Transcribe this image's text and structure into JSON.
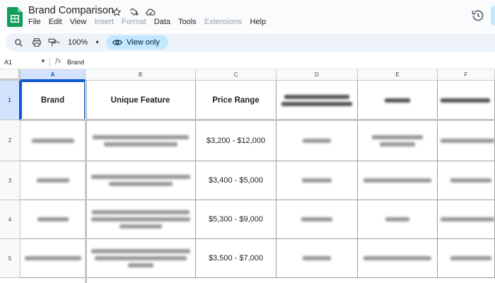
{
  "app": {
    "doc_title": "Brand Comparison",
    "menu": [
      {
        "label": "File",
        "enabled": true
      },
      {
        "label": "Edit",
        "enabled": true
      },
      {
        "label": "View",
        "enabled": true
      },
      {
        "label": "Insert",
        "enabled": false
      },
      {
        "label": "Format",
        "enabled": false
      },
      {
        "label": "Data",
        "enabled": true
      },
      {
        "label": "Tools",
        "enabled": true
      },
      {
        "label": "Extensions",
        "enabled": false
      },
      {
        "label": "Help",
        "enabled": true
      }
    ],
    "icons": {
      "app": "sheets-logo-icon",
      "star": "star-icon",
      "move": "move-to-folder-icon",
      "cloud": "cloud-status-icon",
      "history": "version-history-icon"
    },
    "colors": {
      "accent": "#0b57d0",
      "view_only_bg": "#c2e7ff",
      "sheets_green": "#0f9d58"
    }
  },
  "toolbar": {
    "zoom": "100%",
    "view_only_label": "View only"
  },
  "formula_bar": {
    "name_box": "A1",
    "fx_label": "fx",
    "value": "Brand"
  },
  "sheet": {
    "columns": [
      "A",
      "B",
      "C",
      "D",
      "E",
      "F"
    ],
    "rows": [
      "1",
      "2",
      "3",
      "4",
      "5"
    ],
    "header": {
      "a": "Brand",
      "b": "Unique Feature",
      "c": "Price Range"
    },
    "price_ranges": [
      "$3,200 - $12,000",
      "$3,400 - $5,000",
      "$5,300 - $9,000",
      "$3,500 - $7,000"
    ]
  }
}
